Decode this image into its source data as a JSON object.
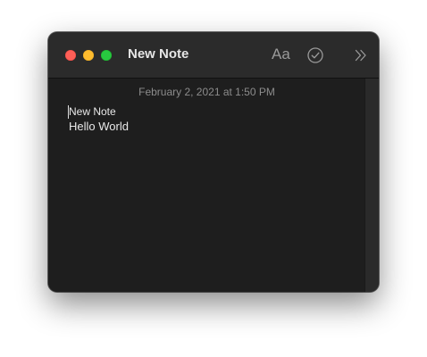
{
  "window": {
    "title": "New Note"
  },
  "toolbar": {
    "format_label": "Aa",
    "checklist_icon": "checkmark-circle-icon",
    "more_icon": "double-chevron-right-icon"
  },
  "note": {
    "timestamp": "February 2, 2021 at 1:50 PM",
    "lines": [
      "New Note",
      "Hello World"
    ]
  },
  "colors": {
    "close": "#fe5f57",
    "minimize": "#febc2e",
    "zoom": "#28c840",
    "background": "#1e1e1e",
    "titlebar": "#2b2b2b"
  }
}
